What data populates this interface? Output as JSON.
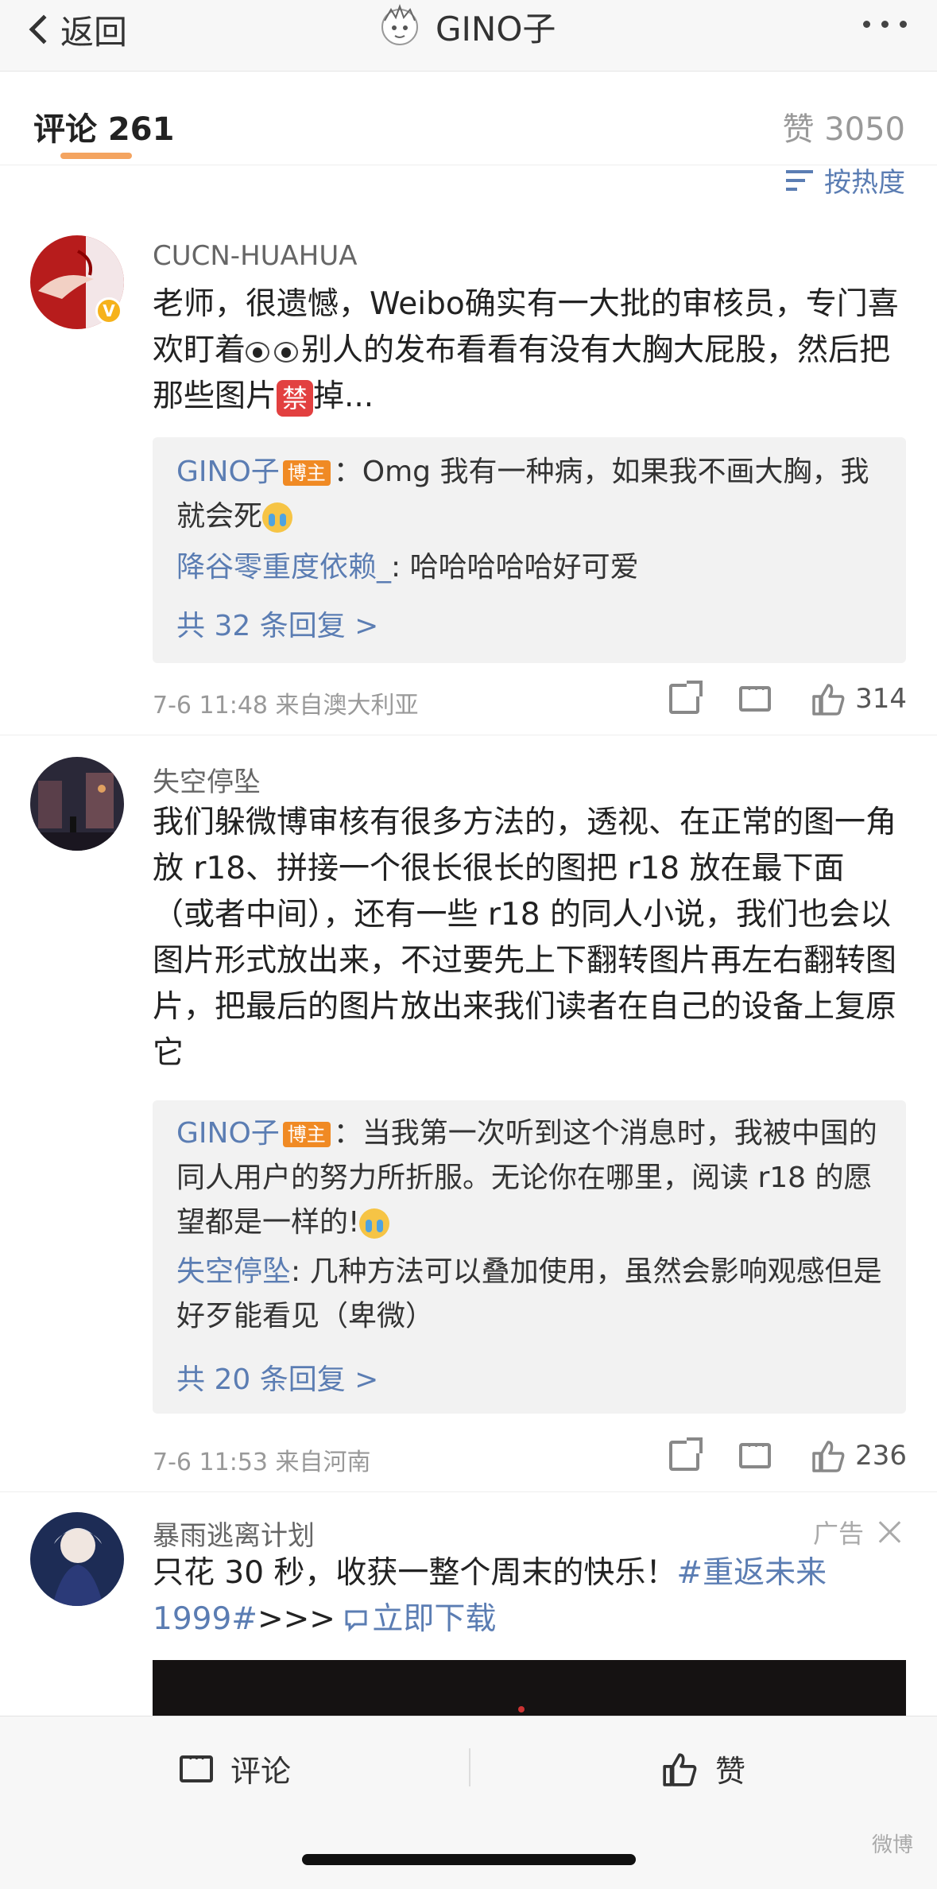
{
  "header": {
    "back_label": "返回",
    "title": "GINO子"
  },
  "tabs": {
    "comments_label": "评论 261",
    "likes_label": "赞 3050"
  },
  "sort": {
    "label": "按热度"
  },
  "comments": [
    {
      "username": "CUCN-HUAHUA",
      "verified": true,
      "text_a": "老师，很遗憾，Weibo确实有一大批的审核员，专门喜欢盯着",
      "text_b": "别人的发布看看有没有大胸大屁股，然后把那些图片",
      "ban_glyph": "禁",
      "text_c": "掉...",
      "replies": [
        {
          "name": "GINO子",
          "badge": "博主",
          "text": "：Omg 我有一种病，如果我不画大胸，我就会死",
          "emoji": "crying-face"
        },
        {
          "name": "降谷零重度依赖_",
          "text": ": 哈哈哈哈哈好可爱"
        }
      ],
      "more_replies": "共 32 条回复 >",
      "meta": "7-6 11:48  来自澳大利亚",
      "likes": "314"
    },
    {
      "username": "失空停坠",
      "text": "我们躲微博审核有很多方法的，透视、在正常的图一角放 r18、拼接一个很长很长的图把 r18 放在最下面（或者中间），还有一些 r18 的同人小说，我们也会以图片形式放出来，不过要先上下翻转图片再左右翻转图片，把最后的图片放出来我们读者在自己的设备上复原它",
      "replies": [
        {
          "name": "GINO子",
          "badge": "博主",
          "text": "：当我第一次听到这个消息时，我被中国的同人用户的努力所折服。无论你在哪里，阅读 r18 的愿望都是一样的!",
          "emoji": "crying-face"
        },
        {
          "name": "失空停坠",
          "text": ": 几种方法可以叠加使用，虽然会影响观感但是好歹能看见（卑微）"
        }
      ],
      "more_replies": "共 20 条回复 >",
      "meta": "7-6 11:53  来自河南",
      "likes": "236"
    }
  ],
  "ad": {
    "username": "暴雨逃离计划",
    "tag": "广告",
    "text_a": "只花 30 秒，收获一整个周末的快乐！",
    "hashtag_a": "#重返未来",
    "hashtag_b": "1999#",
    "text_b": ">>> ",
    "link": "立即下载"
  },
  "bottom_bar": {
    "comment_label": "评论",
    "like_label": "赞"
  },
  "watermark": "微博"
}
